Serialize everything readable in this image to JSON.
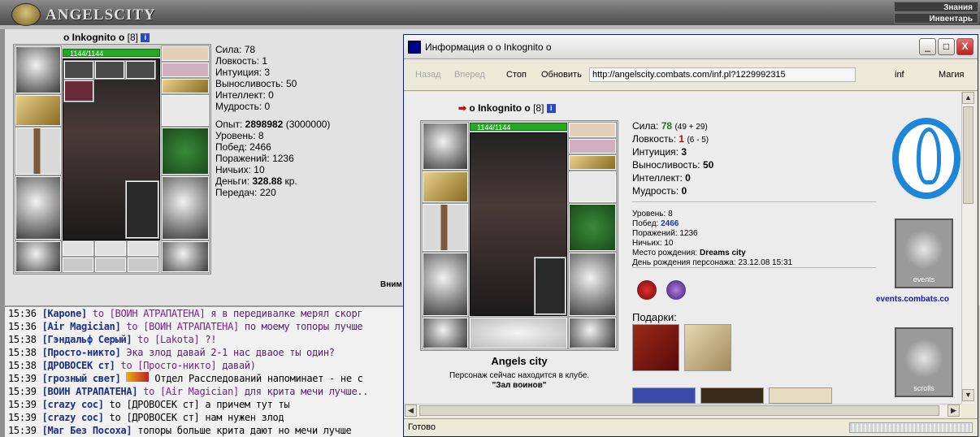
{
  "topbar": {
    "brand": "ANGELSCITY",
    "menu": [
      "Знания",
      "Инвентарь"
    ]
  },
  "character": {
    "name": "o Inkognito o",
    "level": "[8]",
    "hp": "1144/1144",
    "stats": [
      {
        "label": "Сила:",
        "value": "78"
      },
      {
        "label": "Ловкость:",
        "value": "1"
      },
      {
        "label": "Интуиция:",
        "value": "3"
      },
      {
        "label": "Выносливость:",
        "value": "50"
      },
      {
        "label": "Интеллект:",
        "value": "0"
      },
      {
        "label": "Мудрость:",
        "value": "0"
      }
    ],
    "exp_label": "Опыт:",
    "exp_value": "2898982",
    "exp_next": "(3000000)",
    "level_label": "Уровень:",
    "level_value": "8",
    "wins_label": "Побед:",
    "wins_value": "2466",
    "losses_label": "Поражений:",
    "losses_value": "1236",
    "draws_label": "Ничьих:",
    "draws_value": "10",
    "money_label": "Деньги:",
    "money_value": "328.88",
    "money_unit": "кр.",
    "transfers_label": "Передач:",
    "transfers_value": "220",
    "attention": "Вним"
  },
  "chat": [
    {
      "time": "15:36",
      "nick": "[Kapone]",
      "to": "to [ВОИН АТРАПАТЕНА]",
      "msg": "я в передивалке мерял скорг"
    },
    {
      "time": "15:36",
      "nick": "[Air Magician]",
      "to": "to [ВОИН АТРАПАТЕНА]",
      "msg": "по моему топоры лучше"
    },
    {
      "time": "15:38",
      "nick": "[Гэндальф Серый]",
      "to": "to [Lakota]",
      "msg": "?!"
    },
    {
      "time": "15:38",
      "nick": "[Просто-никто]",
      "to": "",
      "msg": "Эка злод давай 2-1 нас дваое ты один?"
    },
    {
      "time": "15:38",
      "nick": "[ДРОВОСЕК ст]",
      "to": "to [Просто-никто]",
      "msg": "давай)"
    },
    {
      "time": "15:39",
      "nick": "[грозный свет]",
      "to": "",
      "msg": "Отдел Расследований напоминает - не с"
    },
    {
      "time": "15:39",
      "nick": "[ВОИН АТРАПАТЕНА]",
      "to": "to [Air Magician]",
      "msg": "для крита мечи лучше.."
    },
    {
      "time": "15:39",
      "nick": "[crazy coc]",
      "to": "to [ДРОВОСЕК ст]",
      "msg": "а причем тут ты"
    },
    {
      "time": "15:39",
      "nick": "[crazy coc]",
      "to": "to [ДРОВОСЕК ст]",
      "msg": "нам нужен злод"
    },
    {
      "time": "15:39",
      "nick": "[Маг Без Посоха]",
      "to": "",
      "msg": "топоры больше крита дают но мечи лучше"
    }
  ],
  "window": {
    "title": "Информация о o Inkognito o",
    "buttons": {
      "minimize": "_",
      "maximize": "□",
      "close": "X"
    },
    "toolbar": {
      "back": "Назад",
      "forward": "Вперед",
      "stop": "Стоп",
      "refresh": "Обновить",
      "url": "http://angelscity.combats.com/inf.pl?1229992315",
      "inf": "inf",
      "magic": "Магия"
    },
    "status": "Готово",
    "profile": {
      "name": "o Inkognito o",
      "level": "[8]",
      "hp": "1144/1144",
      "city": "Angels city",
      "location_line": "Персонаж сейчас находится в клубе.",
      "location": "\"Зал воинов\"",
      "stats": [
        {
          "label": "Сила:",
          "value": "78",
          "extra": "(49 + 29)"
        },
        {
          "label": "Ловкость:",
          "value": "1",
          "extra": "(6 - 5)"
        },
        {
          "label": "Интуиция:",
          "value": "3",
          "extra": ""
        },
        {
          "label": "Выносливость:",
          "value": "50",
          "extra": ""
        },
        {
          "label": "Интеллект:",
          "value": "0",
          "extra": ""
        },
        {
          "label": "Мудрость:",
          "value": "0",
          "extra": ""
        }
      ],
      "level_line": "Уровень: 8",
      "wins_label": "Побед:",
      "wins_value": "2466",
      "losses_line": "Поражений: 1236",
      "draws_line": "Ничьих: 10",
      "birthplace_label": "Место рождения:",
      "birthplace_value": "Dreams city",
      "birthday_line": "День рождения персонажа: 23.12.08 15:31",
      "gifts_label": "Подарки:",
      "events_label": "events",
      "events_link": "events.combats.co",
      "scrolls_label": "scrolls"
    }
  }
}
